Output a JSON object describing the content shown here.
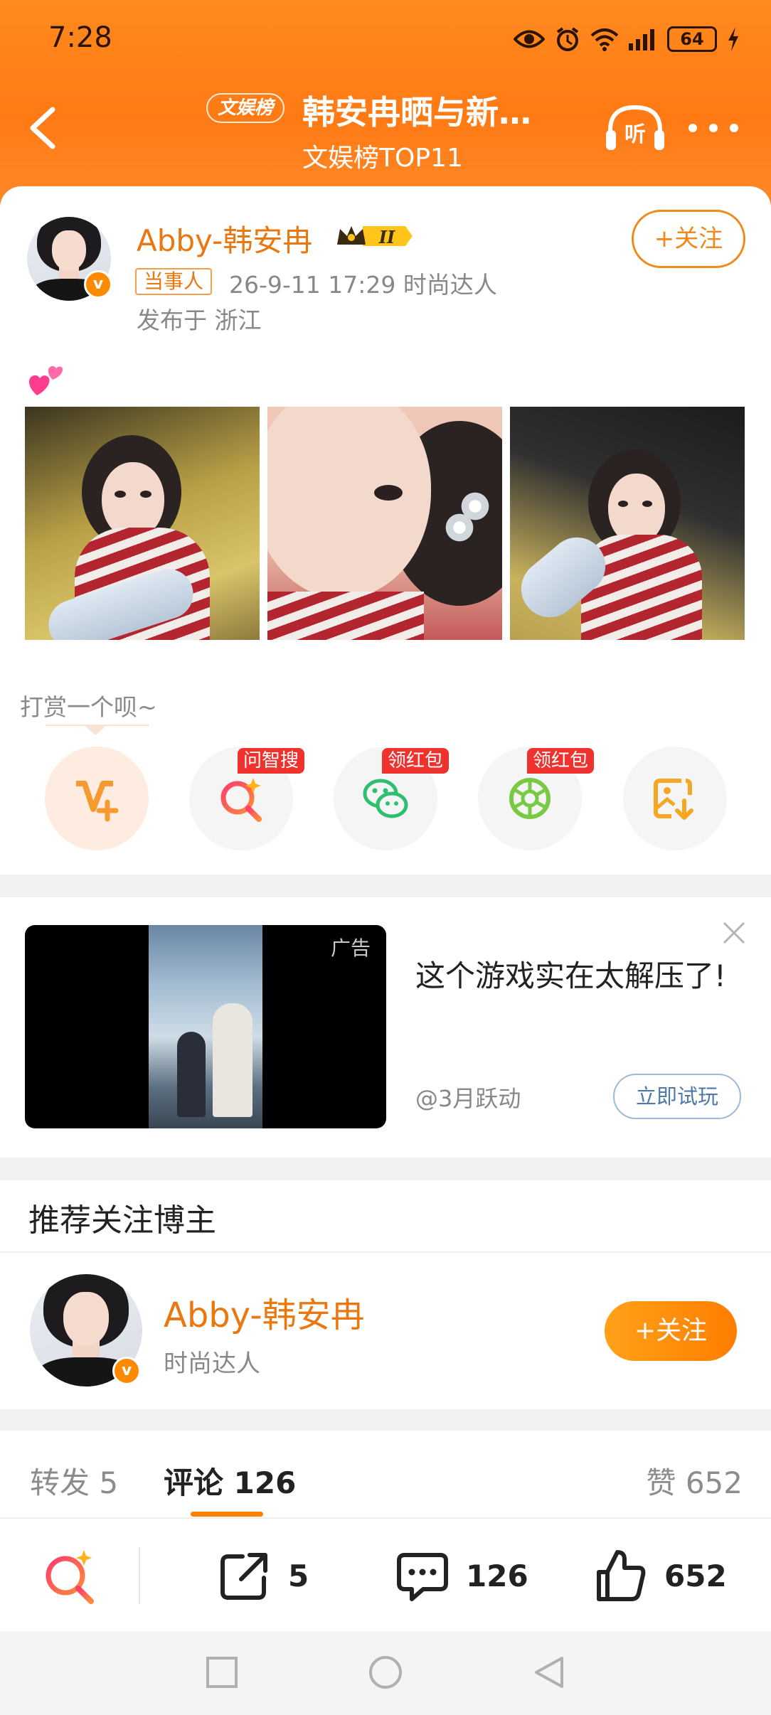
{
  "status_bar": {
    "time": "7:28",
    "battery": "64"
  },
  "header": {
    "tag": "文娱榜",
    "title": "韩安冉晒与新…",
    "subtitle": "文娱榜TOP11",
    "listen_label": "听"
  },
  "post": {
    "author": "Abby-韩安冉",
    "badge_level": "II",
    "follow_label": "+关注",
    "role_tag": "当事人",
    "meta": "26-9-11 17:29  时尚达人",
    "location": "发布于 浙江",
    "verified_mark": "v"
  },
  "tip": {
    "label": "打赏一个呗~",
    "actions": [
      {
        "name": "vplus",
        "tag": ""
      },
      {
        "name": "ask-search",
        "tag": "问智搜"
      },
      {
        "name": "wechat",
        "tag": "领红包"
      },
      {
        "name": "moments",
        "tag": "领红包"
      },
      {
        "name": "save-image",
        "tag": ""
      }
    ]
  },
  "ad": {
    "label": "广告",
    "title": "这个游戏实在太解压了!",
    "handle": "@3月跃动",
    "cta": "立即试玩"
  },
  "recommend": {
    "title": "推荐关注博主",
    "name": "Abby-韩安冉",
    "desc": "时尚达人",
    "follow_label": "+关注"
  },
  "tabs": {
    "repost": "转发 5",
    "comment": "评论 126",
    "like": "赞 652"
  },
  "bottom_bar": {
    "repost_count": "5",
    "comment_count": "126",
    "like_count": "652"
  },
  "colors": {
    "brand_orange": "#ff7a14",
    "accent_text": "#e8780f",
    "tag_red": "#f0322e"
  }
}
